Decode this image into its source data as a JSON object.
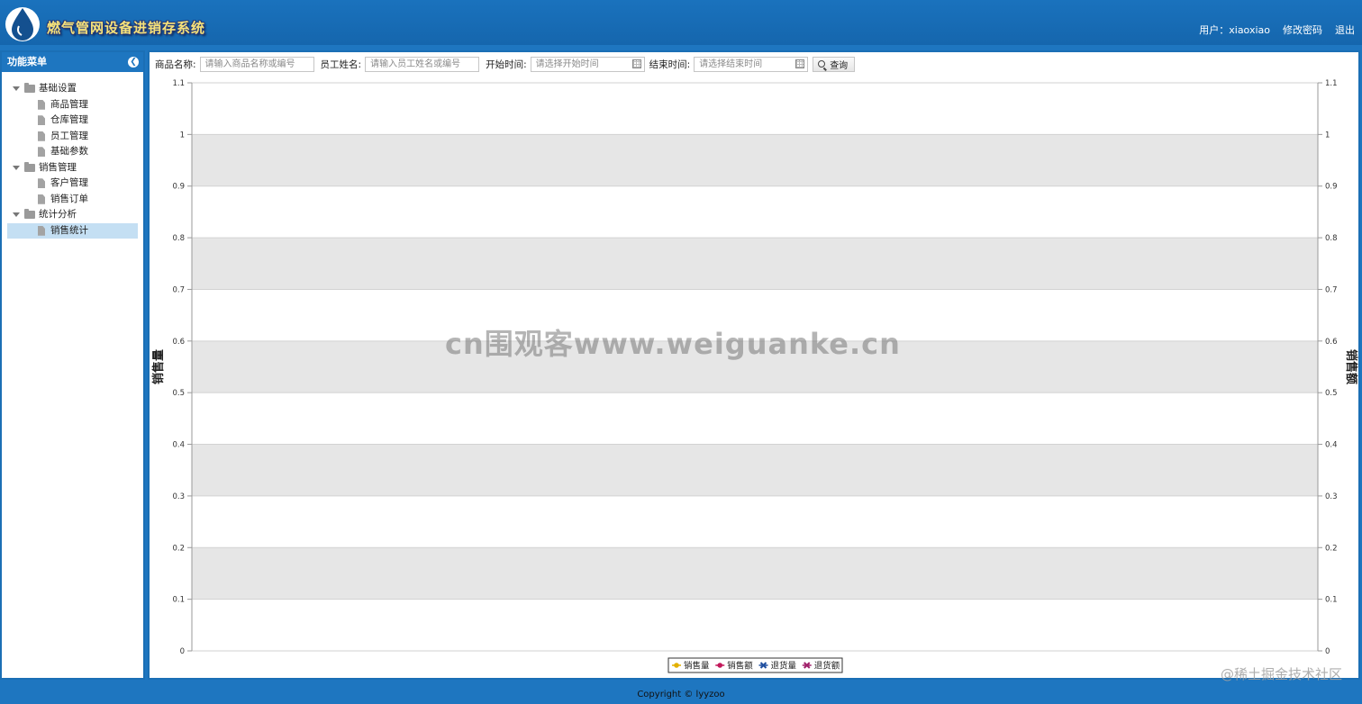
{
  "header": {
    "logo_icon": "water-drop-logo-icon",
    "title": "燃气管网设备进销存系统",
    "user_label": "用户：xiaoxiao",
    "change_password": "修改密码",
    "logout": "退出"
  },
  "sidebar": {
    "title": "功能菜单",
    "collapse_icon": "chevron-left-circle-icon",
    "groups": [
      {
        "label": "基础设置",
        "items": [
          "商品管理",
          "仓库管理",
          "员工管理",
          "基础参数"
        ]
      },
      {
        "label": "销售管理",
        "items": [
          "客户管理",
          "销售订单"
        ]
      },
      {
        "label": "统计分析",
        "items": [
          "销售统计"
        ]
      }
    ],
    "selected": "销售统计"
  },
  "toolbar": {
    "product_label": "商品名称:",
    "product_placeholder": "请输入商品名称或编号",
    "employee_label": "员工姓名:",
    "employee_placeholder": "请输入员工姓名或编号",
    "start_label": "开始时间:",
    "start_placeholder": "请选择开始时间",
    "end_label": "结束时间:",
    "end_placeholder": "请选择结束时间",
    "query_label": "查询"
  },
  "chart_data": {
    "type": "line",
    "ylabel_left": "销售量",
    "ylabel_right": "销售额",
    "ylim": [
      0,
      1.1
    ],
    "yticks": [
      "0",
      "0.1",
      "0.2",
      "0.3",
      "0.4",
      "0.5",
      "0.6",
      "0.7",
      "0.8",
      "0.9",
      "1",
      "1.1"
    ],
    "series": [
      {
        "name": "销售量",
        "color": "#e3b100",
        "values": []
      },
      {
        "name": "销售额",
        "color": "#c2185b",
        "values": []
      },
      {
        "name": "退货量",
        "color": "#1f4fa0",
        "values": []
      },
      {
        "name": "退货额",
        "color": "#a0206b",
        "values": []
      }
    ],
    "grid": true,
    "legend_position": "bottom-center"
  },
  "watermark": "cn围观客www.weiguanke.cn",
  "footer": {
    "copyright": "Copyright © lyyzoo",
    "site_watermark": "@稀土掘金技术社区"
  }
}
